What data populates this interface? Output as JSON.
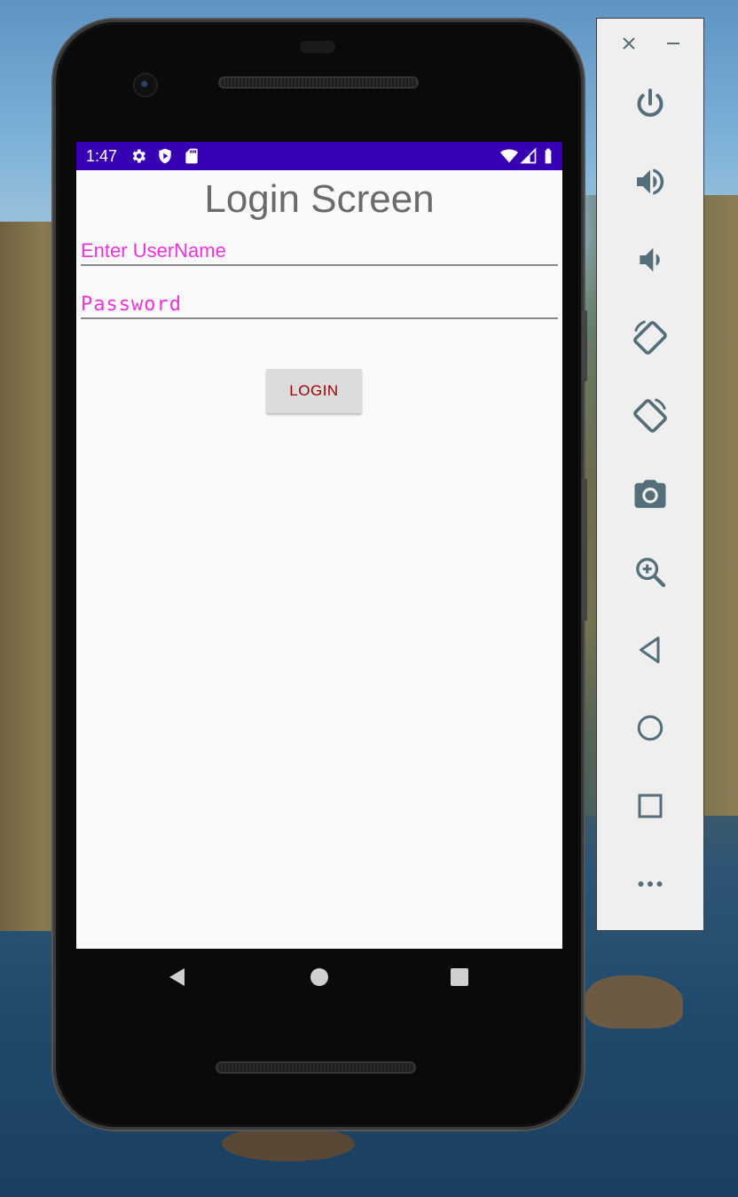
{
  "status_bar": {
    "time": "1:47",
    "icons": [
      "settings-icon",
      "shield-play-icon",
      "sd-card-icon",
      "wifi-icon",
      "signal-icon",
      "battery-icon"
    ],
    "background": "#3700b3"
  },
  "app": {
    "title": "Login Screen",
    "username_placeholder": "Enter UserName",
    "password_placeholder": "Password",
    "login_label": "LOGIN",
    "hint_color": "#ee33dd",
    "button_text_color": "#a40000"
  },
  "nav_bar": {
    "icons": [
      "back-triangle-icon",
      "home-circle-icon",
      "overview-square-icon"
    ]
  },
  "emulator_toolbar": {
    "window_controls": [
      "close-icon",
      "minimize-icon"
    ],
    "buttons": [
      "power-icon",
      "volume-up-icon",
      "volume-down-icon",
      "rotate-left-icon",
      "rotate-right-icon",
      "camera-icon",
      "zoom-icon",
      "back-icon",
      "home-icon",
      "overview-icon",
      "more-icon"
    ],
    "icon_color": "#546e7a"
  }
}
